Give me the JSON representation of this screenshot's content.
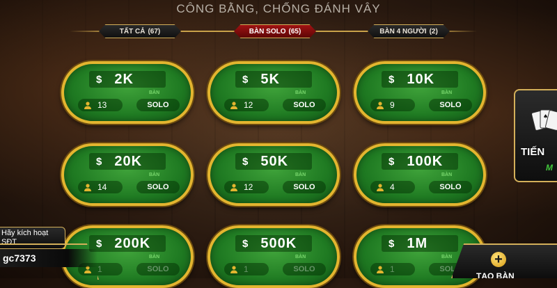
{
  "header": {
    "title": "CÔNG BẰNG, CHỐNG ĐÁNH VÂY"
  },
  "tabs": [
    {
      "label": "TẤT CẢ",
      "count": "(67)",
      "active": false
    },
    {
      "label": "BÀN SOLO",
      "count": "(65)",
      "active": true
    },
    {
      "label": "BÀN 4 NGƯỜI",
      "count": "(2)",
      "active": false
    }
  ],
  "tables": [
    {
      "stake": "2K",
      "players": "13",
      "mode": "SOLO"
    },
    {
      "stake": "5K",
      "players": "12",
      "mode": "SOLO"
    },
    {
      "stake": "10K",
      "players": "9",
      "mode": "SOLO"
    },
    {
      "stake": "20K",
      "players": "14",
      "mode": "SOLO"
    },
    {
      "stake": "50K",
      "players": "12",
      "mode": "SOLO"
    },
    {
      "stake": "100K",
      "players": "4",
      "mode": "SOLO"
    },
    {
      "stake": "200K",
      "players": "1",
      "mode": "SOLO"
    },
    {
      "stake": "500K",
      "players": "1",
      "mode": "SOLO"
    },
    {
      "stake": "1M",
      "players": "1",
      "mode": "SOLO"
    }
  ],
  "table_labels": {
    "currency": "$",
    "ban": "BÀN"
  },
  "side_game": {
    "title": "TIẾN",
    "subtitle": "M"
  },
  "account": {
    "activate_text": "Hãy kích hoạt SĐT",
    "username": "gc7373"
  },
  "create_button": {
    "label": "TẠO BÀN"
  },
  "colors": {
    "felt": "#1f7a22",
    "rim": "#e3b52f",
    "active_tab": "#a01212",
    "accent_green": "#79d86d"
  },
  "icons": {
    "player": "person-icon",
    "create": "plus-icon",
    "side": "playing-cards-icon"
  }
}
